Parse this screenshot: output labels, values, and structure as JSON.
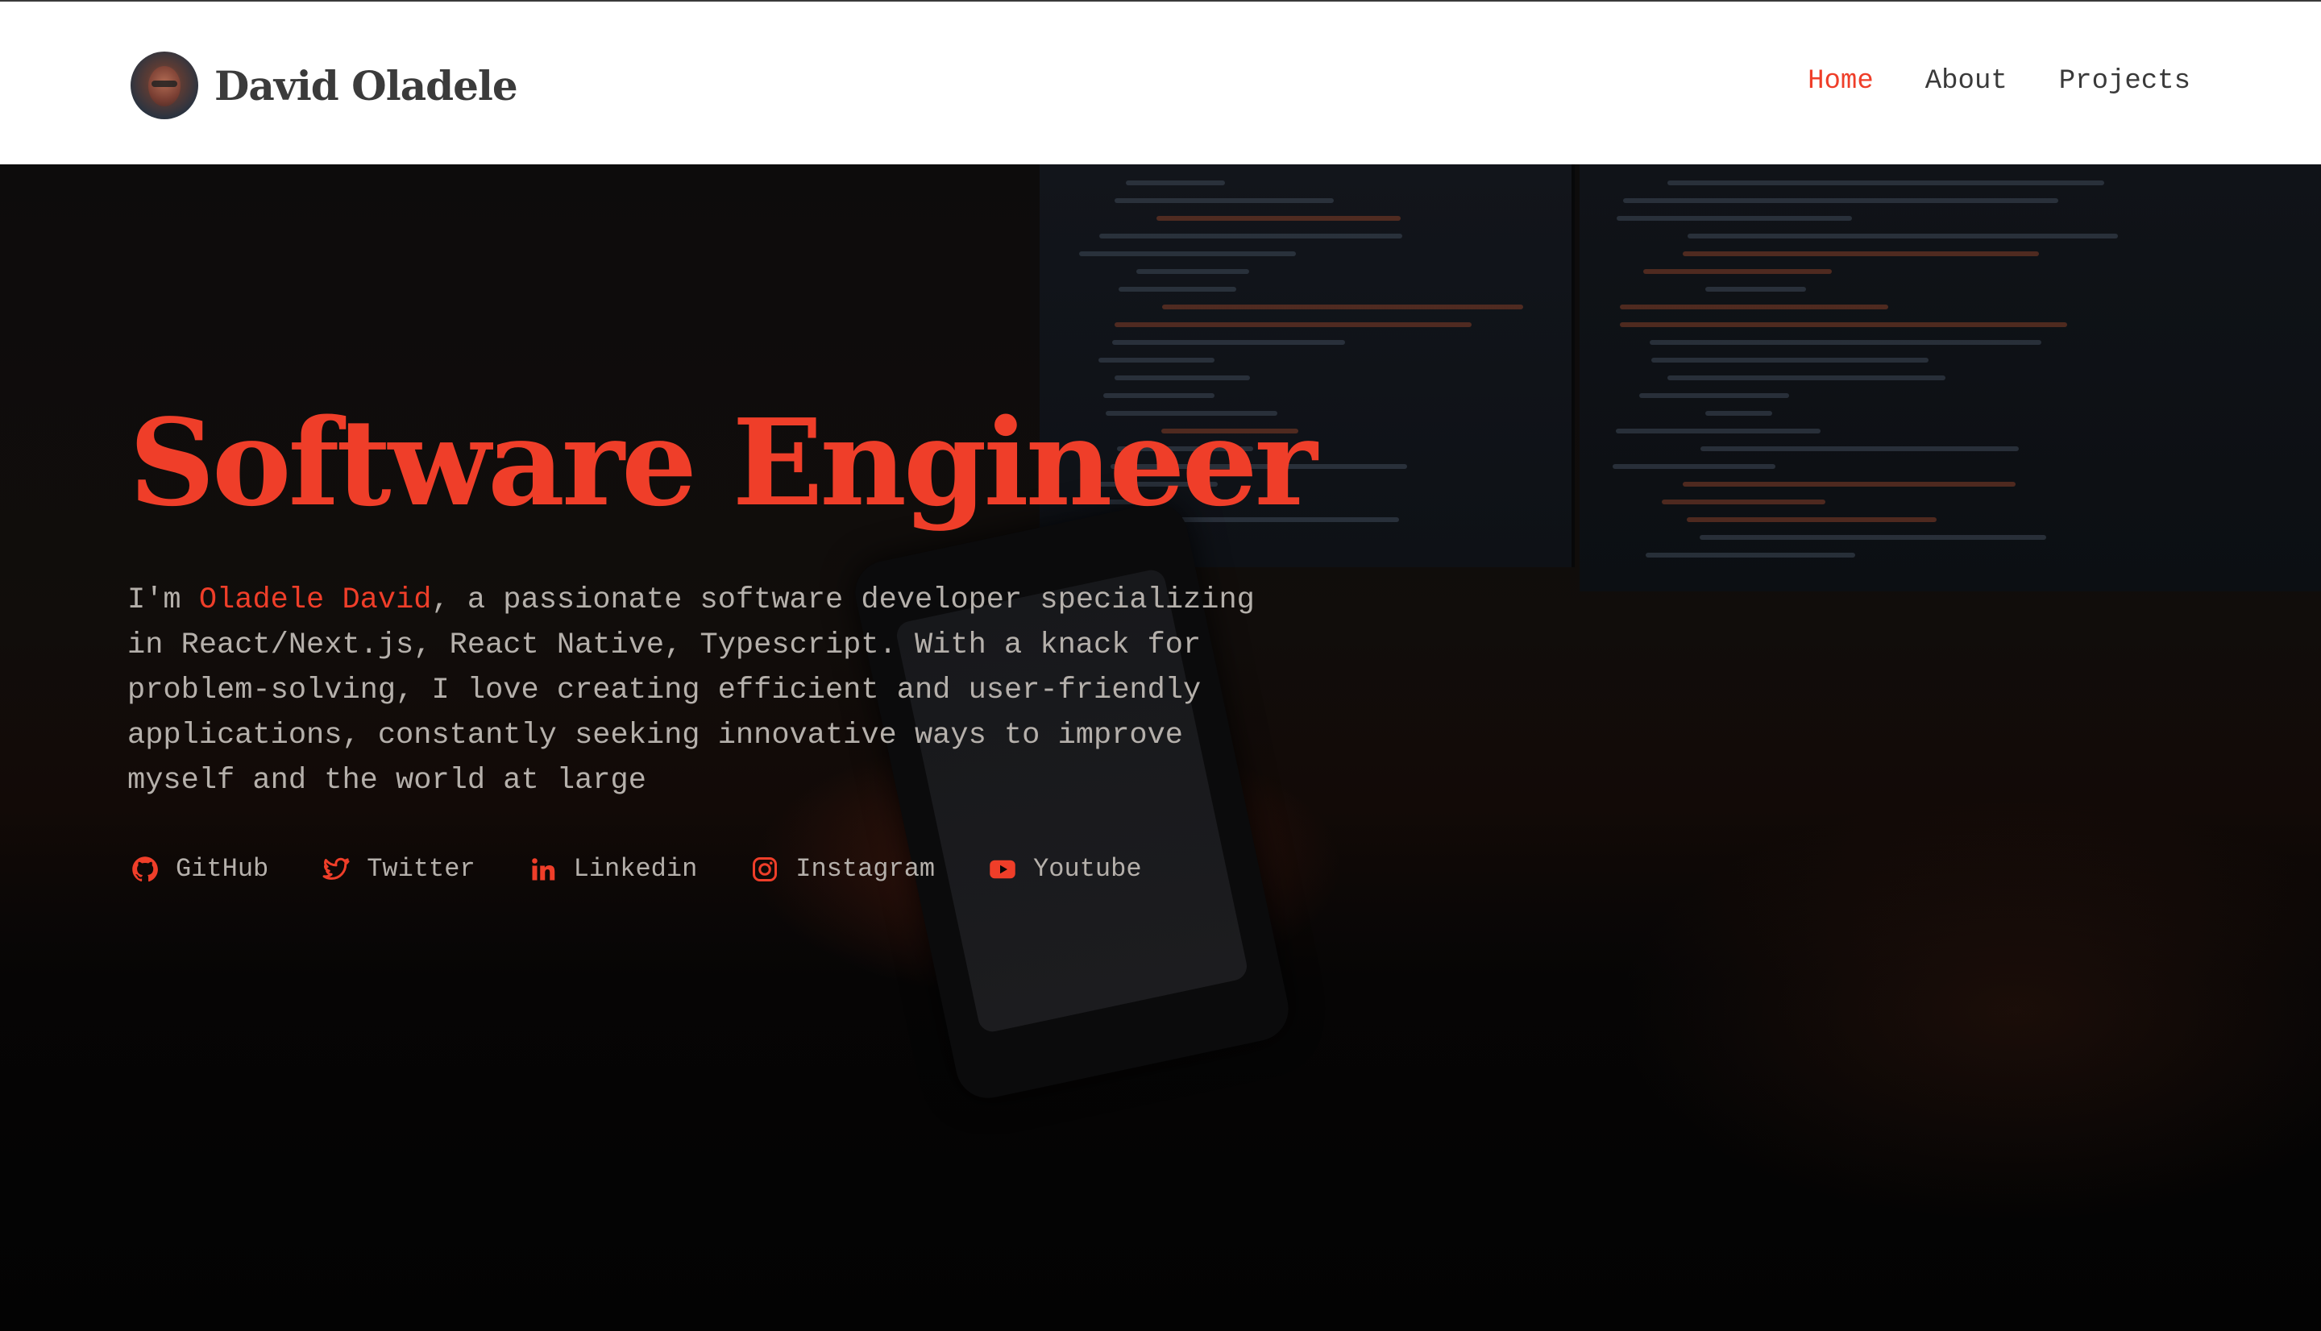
{
  "header": {
    "brand_name": "David Oladele",
    "nav": [
      {
        "label": "Home",
        "active": true
      },
      {
        "label": "About",
        "active": false
      },
      {
        "label": "Projects",
        "active": false
      }
    ]
  },
  "hero": {
    "title": "Software Engineer",
    "bio": {
      "prefix": "I'm ",
      "name": "Oladele David",
      "rest": ", a passionate software developer specializing in React/Next.js, React Native, Typescript. With a knack for problem-solving, I love creating efficient and user-friendly applications, constantly seeking innovative ways to improve myself and the world at large"
    },
    "socials": [
      {
        "label": "GitHub",
        "icon": "github-icon"
      },
      {
        "label": "Twitter",
        "icon": "twitter-icon"
      },
      {
        "label": "Linkedin",
        "icon": "linkedin-icon"
      },
      {
        "label": "Instagram",
        "icon": "instagram-icon"
      },
      {
        "label": "Youtube",
        "icon": "youtube-icon"
      }
    ]
  },
  "colors": {
    "accent": "#ef3e29",
    "text_muted": "#b5b0ab",
    "header_bg": "#ffffff",
    "hero_bg": "#050403"
  }
}
